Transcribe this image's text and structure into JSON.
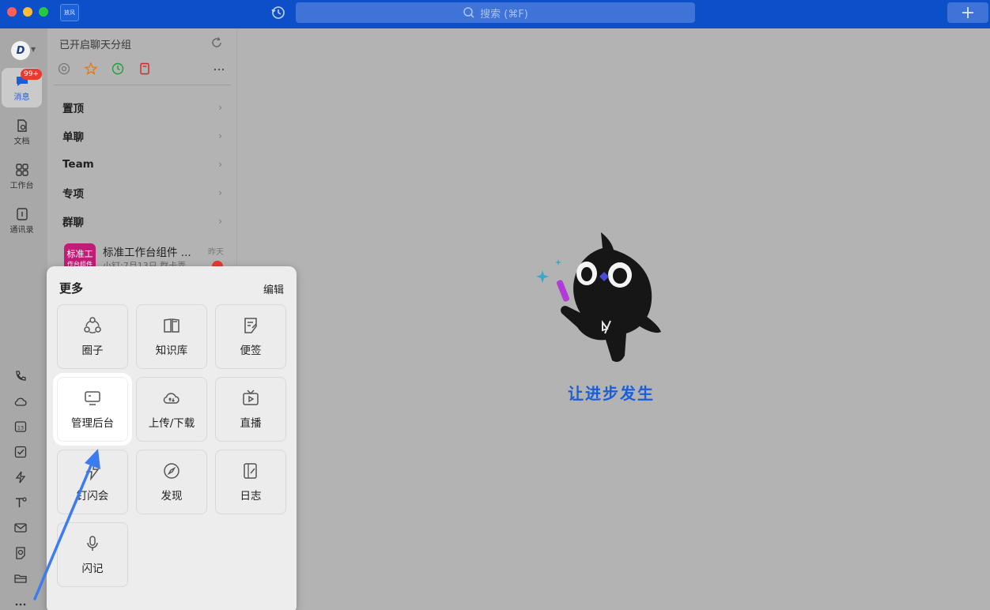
{
  "titlebar": {
    "org_logo_text": "放风",
    "search_placeholder": "搜索 (⌘F)"
  },
  "leftnav": {
    "badge": "99+",
    "items": [
      {
        "label": "消息",
        "icon": "message-icon",
        "active": true
      },
      {
        "label": "文档",
        "icon": "document-icon"
      },
      {
        "label": "工作台",
        "icon": "grid-icon"
      },
      {
        "label": "通讯录",
        "icon": "contacts-icon"
      }
    ],
    "bottom_icons": [
      "phone-icon",
      "cloud-icon",
      "calendar-icon",
      "todo-check-icon",
      "flash-icon",
      "text-tool-icon",
      "mail-icon",
      "note-icon",
      "folder-icon",
      "more-dots-icon"
    ],
    "calendar_day": "13"
  },
  "chatlist": {
    "header": "已开启聊天分组",
    "filter_icons": [
      "at-icon",
      "star-icon",
      "clock-icon",
      "bookmark-icon",
      "more-icon"
    ],
    "groups": [
      "置顶",
      "单聊",
      "Team",
      "专项",
      "群聊"
    ],
    "conversation": {
      "avatar_text": "标准工",
      "avatar_subtext": "作台组件",
      "title": "标准工作台组件 ...",
      "time": "昨天",
      "preview": "小钉:7月13日 群卡弄..."
    }
  },
  "main": {
    "slogan": "让进步发生"
  },
  "more_popup": {
    "title": "更多",
    "edit": "编辑",
    "tiles": [
      {
        "label": "圈子",
        "icon": "circle-group-icon"
      },
      {
        "label": "知识库",
        "icon": "book-icon"
      },
      {
        "label": "便签",
        "icon": "memo-icon"
      },
      {
        "label": "管理后台",
        "icon": "monitor-icon",
        "highlighted": true
      },
      {
        "label": "上传/下载",
        "icon": "cloud-transfer-icon"
      },
      {
        "label": "直播",
        "icon": "live-tv-icon"
      },
      {
        "label": "钉闪会",
        "icon": "flash-meeting-icon"
      },
      {
        "label": "发现",
        "icon": "compass-icon"
      },
      {
        "label": "日志",
        "icon": "log-icon"
      },
      {
        "label": "闪记",
        "icon": "voice-note-icon"
      }
    ]
  },
  "colors": {
    "titlebar": "#0c4fc8",
    "accent": "#1a5ed9",
    "badge": "#e63b2e",
    "arrow": "#3d7cf0"
  }
}
